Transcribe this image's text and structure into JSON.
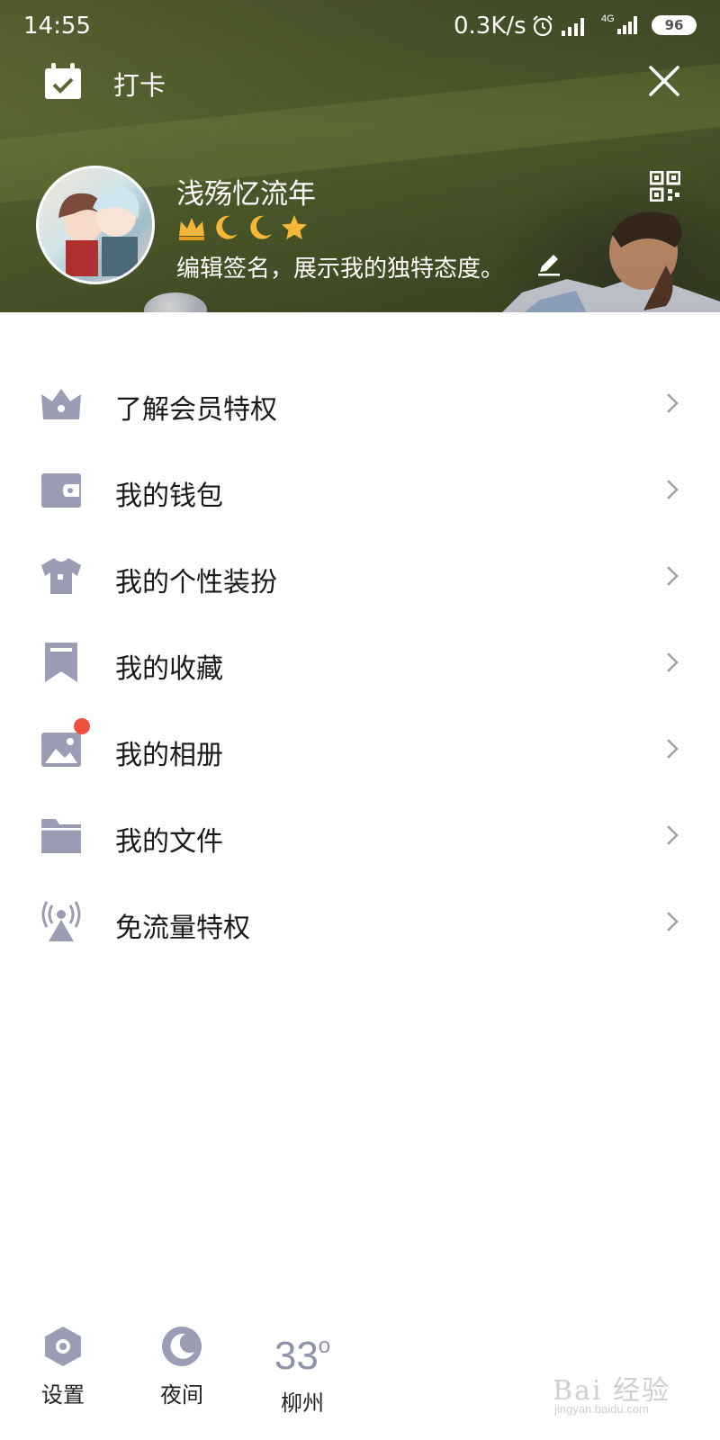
{
  "status_bar": {
    "time": "14:55",
    "net_speed": "0.3K/s",
    "network_type": "4G",
    "battery": "96"
  },
  "header": {
    "checkin_label": "打卡",
    "nickname": "浅殇忆流年",
    "signature": "编辑签名，展示我的独特态度。",
    "badges": [
      "crown-icon",
      "moon-icon",
      "moon-icon",
      "star-icon"
    ]
  },
  "menu": {
    "items": [
      {
        "label": "了解会员特权",
        "icon": "vip-crown-icon"
      },
      {
        "label": "我的钱包",
        "icon": "wallet-icon"
      },
      {
        "label": "我的个性装扮",
        "icon": "shirt-icon"
      },
      {
        "label": "我的收藏",
        "icon": "bookmark-icon"
      },
      {
        "label": "我的相册",
        "icon": "photo-album-icon"
      },
      {
        "label": "我的文件",
        "icon": "folder-icon"
      },
      {
        "label": "免流量特权",
        "icon": "antenna-icon"
      }
    ]
  },
  "bottom_bar": {
    "settings_label": "设置",
    "night_label": "夜间",
    "temperature": "33",
    "temperature_unit": "o",
    "city": "柳州"
  },
  "watermark": {
    "text": "Bai 经验",
    "sub": "jingyan.baidu.com"
  },
  "colors": {
    "icon": "#9a9db3",
    "accent_dot": "#f2503f",
    "text": "#1a1a1a"
  }
}
